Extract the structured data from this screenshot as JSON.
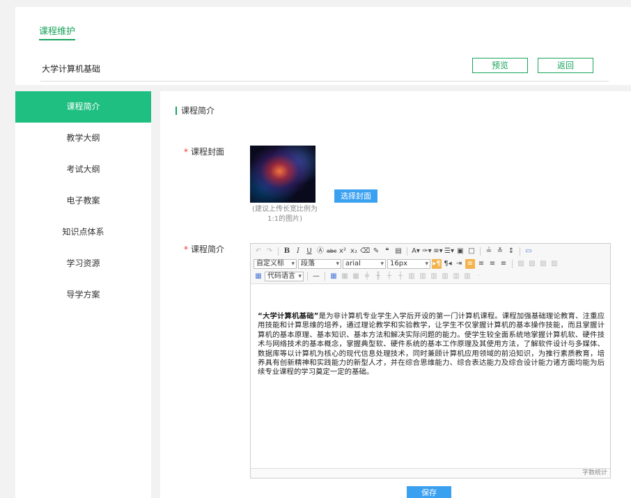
{
  "header": {
    "breadcrumb": "课程维护",
    "course_name": "大学计算机基础",
    "preview_label": "预览",
    "back_label": "返回"
  },
  "sidebar": {
    "items": [
      {
        "label": "课程简介",
        "active": true
      },
      {
        "label": "教学大纲"
      },
      {
        "label": "考试大纲"
      },
      {
        "label": "电子教案"
      },
      {
        "label": "知识点体系"
      },
      {
        "label": "学习资源"
      },
      {
        "label": "导学方案"
      }
    ]
  },
  "main": {
    "section_title": "课程简介",
    "required_mark": "*",
    "cover_label": "课程封面",
    "select_cover_label": "选择封面",
    "cover_hint": "(建议上传长宽比例为1:1的图片)",
    "intro_label": "课程简介",
    "save_label": "保存"
  },
  "editor": {
    "font_style": "自定义标",
    "paragraph": "段落",
    "font_family": "arial",
    "font_size": "16px",
    "code_language": "代码语言",
    "content_bold": "“大学计算机基础”",
    "content_text": "是为非计算机专业学生入学后开设的第一门计算机课程。课程加强基础理论教育、注重应用技能和计算思维的培养，通过理论教学和实验教学，让学生不仅掌握计算机的基本操作技能，而且掌握计算机的基本原理、基本知识、基本方法和解决实际问题的能力。使学生较全面系统地掌握计算机软、硬件技术与网络技术的基本概念，掌握典型软、硬件系统的基本工作原理及其使用方法，了解软件设计与多媒体、数据库等以计算机为核心的现代信息处理技术，同时兼顾计算机应用领域的前沿知识，为推行素质教育，培养具有创新精神和实践能力的新型人才，并在综合思维能力、综合表达能力及综合设计能力诸方面均能为后续专业课程的学习奠定一定的基础。",
    "word_count_label": "字数统计"
  },
  "colors": {
    "accent_green": "#17a35a",
    "active_green": "#1ebf80",
    "button_blue": "#3aa0f0",
    "required_red": "#e33333"
  }
}
